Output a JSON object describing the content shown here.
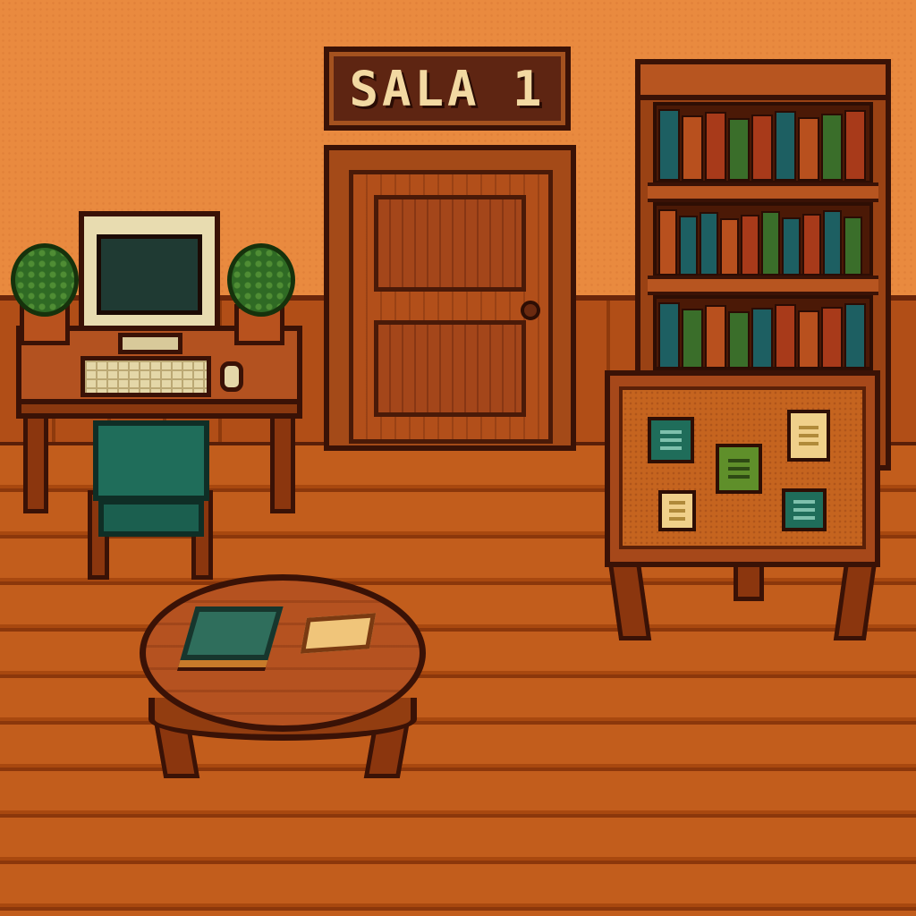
{
  "scene": {
    "sign": {
      "text": "SALA 1"
    },
    "colors": {
      "wall": "#e98a3f",
      "floor": "#c25d1c",
      "wood_dark": "#3a1206",
      "chair_green": "#1f6d5a",
      "plant_green": "#2f6a24",
      "monitor_beige": "#e8dcb0"
    },
    "objects": [
      "door",
      "bookshelf",
      "notice-board",
      "computer-desk",
      "computer-monitor",
      "keyboard",
      "mouse",
      "potted-plant",
      "potted-plant",
      "chair",
      "round-table",
      "book",
      "paper"
    ],
    "bookshelf": {
      "shelves": [
        {
          "books": [
            "#1d5f62",
            "#b8501e",
            "#a83a1a",
            "#3a6e2a",
            "#a83a1a",
            "#1d5f62",
            "#b8501e",
            "#3a6e2a",
            "#a83a1a"
          ]
        },
        {
          "books": [
            "#b8501e",
            "#1d5f62",
            "#1d5f62",
            "#b8501e",
            "#a83a1a",
            "#3a6e2a",
            "#1d5f62",
            "#a83a1a",
            "#1d5f62",
            "#3a6e2a"
          ]
        },
        {
          "books": [
            "#1d5f62",
            "#3a6e2a",
            "#b8501e",
            "#3a6e2a",
            "#1d5f62",
            "#a83a1a",
            "#b8501e",
            "#a83a1a",
            "#1d5f62"
          ]
        }
      ]
    },
    "notice_board": {
      "notes": [
        {
          "color": "#1f6d5a",
          "line": "#7ec1ad"
        },
        {
          "color": "#f0d08a",
          "line": "#b08a3a"
        },
        {
          "color": "#5f8f2a",
          "line": "#2e4a14"
        },
        {
          "color": "#f0d08a",
          "line": "#b08a3a"
        },
        {
          "color": "#1f6d5a",
          "line": "#7ec1ad"
        }
      ]
    }
  }
}
